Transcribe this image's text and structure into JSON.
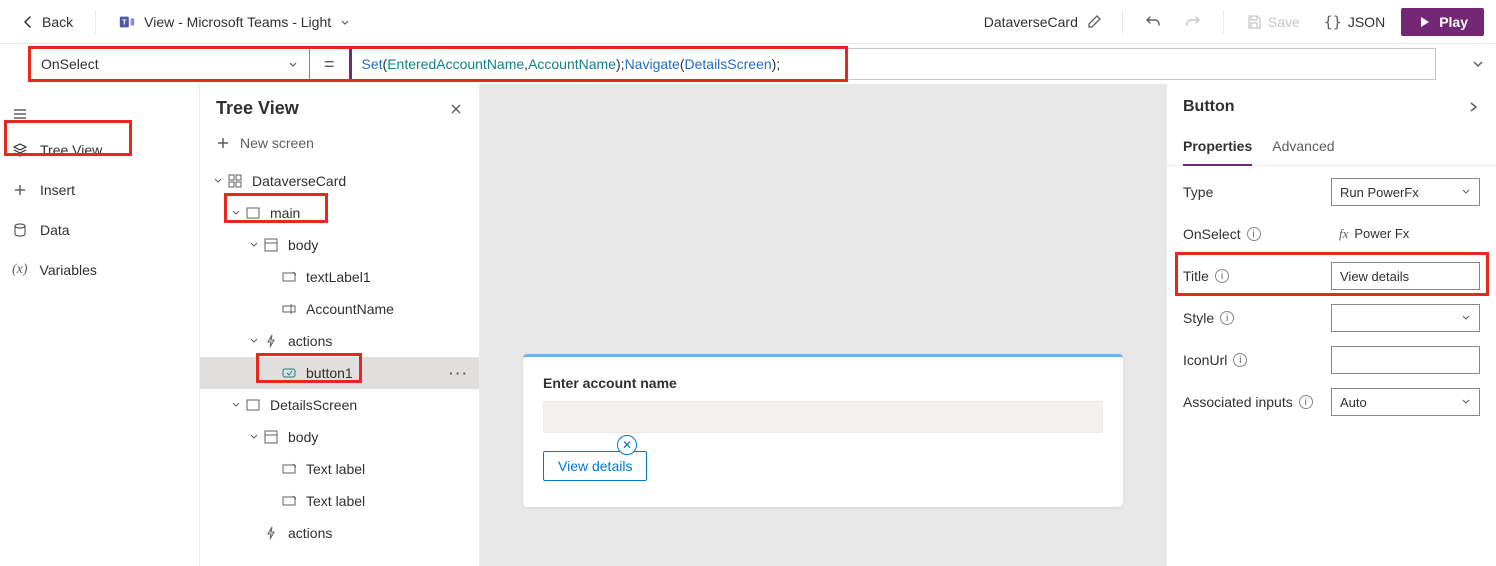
{
  "topbar": {
    "back_label": "Back",
    "theme_label": "View - Microsoft Teams - Light",
    "app_name": "DataverseCard",
    "save_label": "Save",
    "json_label": "JSON",
    "play_label": "Play"
  },
  "formula": {
    "property": "OnSelect",
    "tokens": {
      "fn1": "Set",
      "open1": "(",
      "arg1": "EnteredAccountName",
      "comma": ", ",
      "arg2": "AccountName",
      "close1": "); ",
      "fn2": "Navigate",
      "open2": "(",
      "arg3": "DetailsScreen",
      "close2": ");"
    }
  },
  "leftrail": {
    "tree_view": "Tree View",
    "insert": "Insert",
    "data": "Data",
    "variables": "Variables"
  },
  "tree": {
    "title": "Tree View",
    "new_screen": "New screen",
    "items": {
      "root": "DataverseCard",
      "main": "main",
      "body": "body",
      "textlabel1": "textLabel1",
      "accountname": "AccountName",
      "actions": "actions",
      "button1": "button1",
      "detailsscreen": "DetailsScreen",
      "body2": "body",
      "textlabel_a": "Text label",
      "textlabel_b": "Text label",
      "actions2": "actions"
    }
  },
  "canvas": {
    "label": "Enter account name",
    "button": "View details"
  },
  "proppanel": {
    "title": "Button",
    "tabs": {
      "properties": "Properties",
      "advanced": "Advanced"
    },
    "rows": {
      "type_label": "Type",
      "type_value": "Run PowerFx",
      "onselect_label": "OnSelect",
      "onselect_value": "Power Fx",
      "title_label": "Title",
      "title_value": "View details",
      "style_label": "Style",
      "iconurl_label": "IconUrl",
      "assoc_label": "Associated inputs",
      "assoc_value": "Auto"
    }
  }
}
